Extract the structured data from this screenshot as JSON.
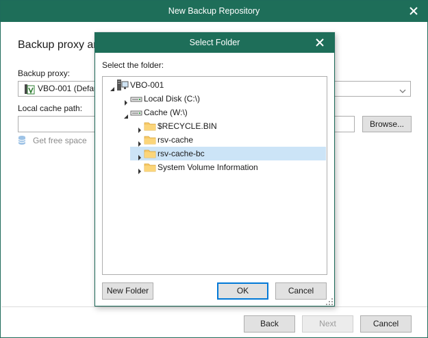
{
  "window": {
    "title": "New Backup Repository",
    "heading": "Backup proxy an",
    "proxy_label": "Backup proxy:",
    "proxy_value": "VBO-001 (Defau",
    "cache_label": "Local cache path:",
    "cache_value": "",
    "browse_label": "Browse...",
    "free_space_label": "Get free space",
    "back_label": "Back",
    "next_label": "Next",
    "cancel_label": "Cancel",
    "next_enabled": false
  },
  "dialog": {
    "title": "Select Folder",
    "prompt": "Select the folder:",
    "tree": [
      {
        "id": "vbo",
        "label": "VBO-001",
        "icon": "server-icon",
        "expanded": true
      },
      {
        "id": "c",
        "label": "Local Disk (C:\\)",
        "icon": "drive-icon",
        "expanded": false
      },
      {
        "id": "w",
        "label": "Cache (W:\\)",
        "icon": "drive-icon",
        "expanded": true
      },
      {
        "id": "recycle",
        "label": "$RECYCLE.BIN",
        "icon": "folder-icon",
        "expanded": false
      },
      {
        "id": "rsvcache",
        "label": "rsv-cache",
        "icon": "folder-icon",
        "expanded": false
      },
      {
        "id": "rsvcachebc",
        "label": "rsv-cache-bc",
        "icon": "folder-icon",
        "expanded": false,
        "selected": true
      },
      {
        "id": "svi",
        "label": "System Volume Information",
        "icon": "folder-icon",
        "expanded": false
      }
    ],
    "new_folder_label": "New Folder",
    "ok_label": "OK",
    "cancel_label": "Cancel"
  },
  "colors": {
    "title_bar": "#1e6e59",
    "selection": "#cce4f7",
    "focus_border": "#0078d7",
    "folder": "#f6c969"
  }
}
